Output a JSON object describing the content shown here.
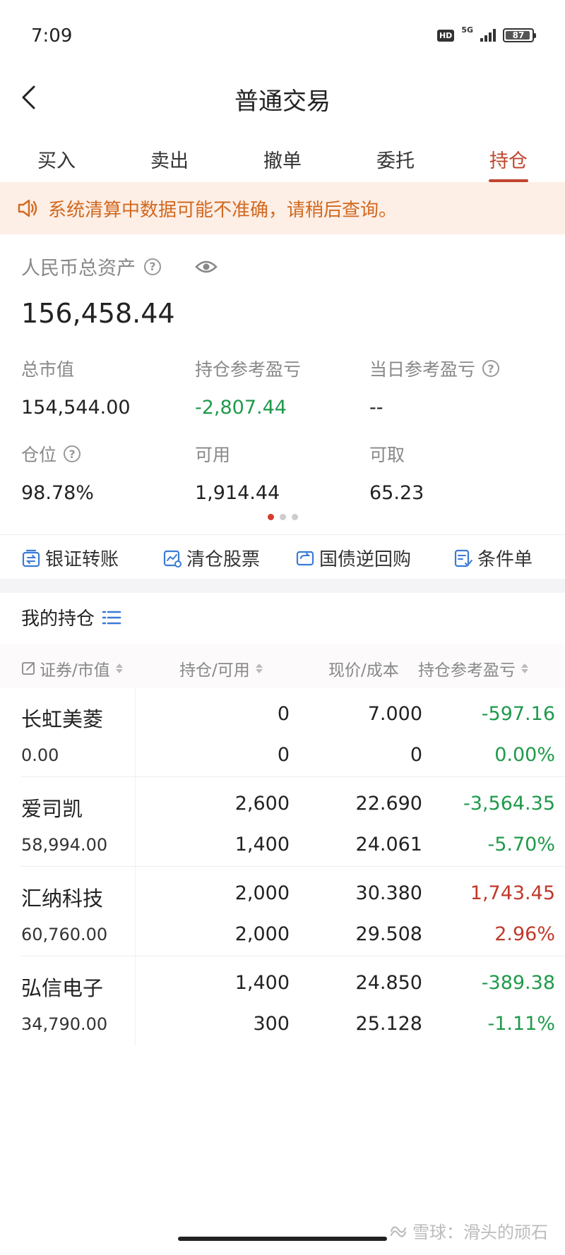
{
  "status_bar": {
    "time": "7:09",
    "hd": "HD",
    "network": "5G",
    "battery": "87"
  },
  "header": {
    "title": "普通交易"
  },
  "tabs": [
    {
      "label": "买入",
      "active": false
    },
    {
      "label": "卖出",
      "active": false
    },
    {
      "label": "撤单",
      "active": false
    },
    {
      "label": "委托",
      "active": false
    },
    {
      "label": "持仓",
      "active": true
    }
  ],
  "notice": {
    "text": "系统清算中数据可能不准确，请稍后查询。"
  },
  "assets": {
    "total_label": "人民币总资产",
    "total_value": "156,458.44",
    "market_value_label": "总市值",
    "market_value": "154,544.00",
    "position_pl_label": "持仓参考盈亏",
    "position_pl": "-2,807.44",
    "daily_pl_label": "当日参考盈亏",
    "daily_pl": "--",
    "position_ratio_label": "仓位",
    "position_ratio": "98.78%",
    "available_label": "可用",
    "available": "1,914.44",
    "withdrawable_label": "可取",
    "withdrawable": "65.23"
  },
  "quick_actions": {
    "bank_transfer": "银证转账",
    "clear_stocks": "清仓股票",
    "reverse_repo": "国债逆回购",
    "condition_order": "条件单"
  },
  "holdings": {
    "title": "我的持仓",
    "columns": {
      "security": "证券/市值",
      "position": "持仓/可用",
      "price": "现价/成本",
      "pl": "持仓参考盈亏"
    },
    "rows": [
      {
        "name": "长虹美菱",
        "market_value": "0.00",
        "position": "0",
        "available": "0",
        "price": "7.000",
        "cost": "0",
        "pl": "-597.16",
        "pl_pct": "0.00%",
        "pl_sign": "loss"
      },
      {
        "name": "爱司凯",
        "market_value": "58,994.00",
        "position": "2,600",
        "available": "1,400",
        "price": "22.690",
        "cost": "24.061",
        "pl": "-3,564.35",
        "pl_pct": "-5.70%",
        "pl_sign": "loss"
      },
      {
        "name": "汇纳科技",
        "market_value": "60,760.00",
        "position": "2,000",
        "available": "2,000",
        "price": "30.380",
        "cost": "29.508",
        "pl": "1,743.45",
        "pl_pct": "2.96%",
        "pl_sign": "gain"
      },
      {
        "name": "弘信电子",
        "market_value": "34,790.00",
        "position": "1,400",
        "available": "300",
        "price": "24.850",
        "cost": "25.128",
        "pl": "-389.38",
        "pl_pct": "-1.11%",
        "pl_sign": "loss"
      }
    ]
  },
  "watermark": "雪球：滑头的顽石",
  "colors": {
    "accent": "#c0452e",
    "loss": "#1f9a4b",
    "gain": "#c0392b",
    "notice_bg": "#fdeee6",
    "notice_text": "#d2691e"
  }
}
